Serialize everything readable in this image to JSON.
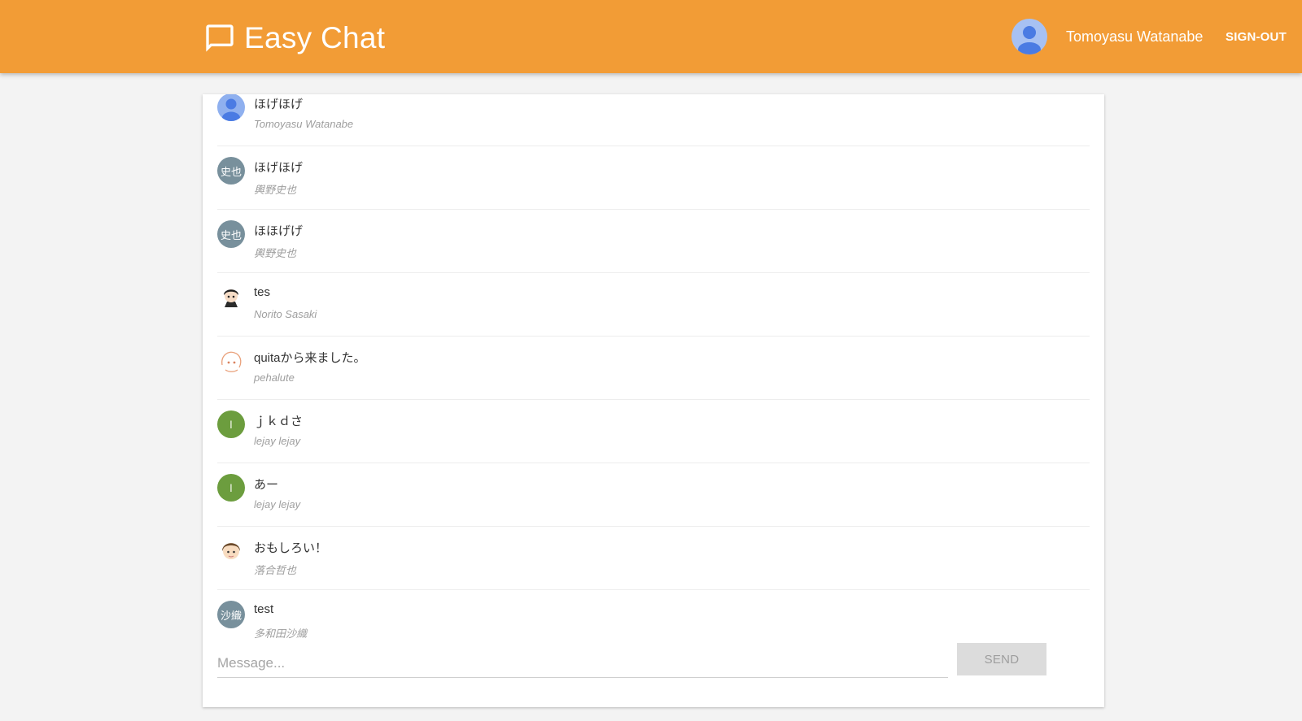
{
  "app": {
    "title": "Easy Chat",
    "brand_color": "#f29c36"
  },
  "user": {
    "name": "Tomoyasu Watanabe",
    "signout_label": "SIGN-OUT",
    "avatar_icon": "person-icon"
  },
  "messages": [
    {
      "text": "ほげほげ",
      "author": "Tomoyasu Watanabe",
      "avatar": {
        "type": "icon",
        "icon": "person-icon",
        "color": "#8fb0ef"
      }
    },
    {
      "text": "ほげほげ",
      "author": "輿野史也",
      "avatar": {
        "type": "initials",
        "initials": "史也",
        "color": "#78909c"
      }
    },
    {
      "text": "ほほげげ",
      "author": "輿野史也",
      "avatar": {
        "type": "initials",
        "initials": "史也",
        "color": "#78909c"
      }
    },
    {
      "text": "tes",
      "author": "Norito Sasaki",
      "avatar": {
        "type": "image",
        "icon": "boy-dark-hair-icon"
      }
    },
    {
      "text": "quitaから来ました。",
      "author": "pehalute",
      "avatar": {
        "type": "image",
        "icon": "sketch-girl-icon"
      }
    },
    {
      "text": "ｊｋｄさ",
      "author": "lejay lejay",
      "avatar": {
        "type": "initials",
        "initials": "l",
        "color": "#6c9d3e"
      }
    },
    {
      "text": "あー",
      "author": "lejay lejay",
      "avatar": {
        "type": "initials",
        "initials": "l",
        "color": "#6c9d3e"
      }
    },
    {
      "text": "おもしろい！",
      "author": "落合哲也",
      "avatar": {
        "type": "image",
        "icon": "boy-brown-hair-icon"
      }
    },
    {
      "text": "test",
      "author": "多和田沙織",
      "avatar": {
        "type": "initials",
        "initials": "沙織",
        "color": "#78909c"
      }
    }
  ],
  "composer": {
    "placeholder": "Message...",
    "value": "",
    "send_label": "SEND"
  }
}
